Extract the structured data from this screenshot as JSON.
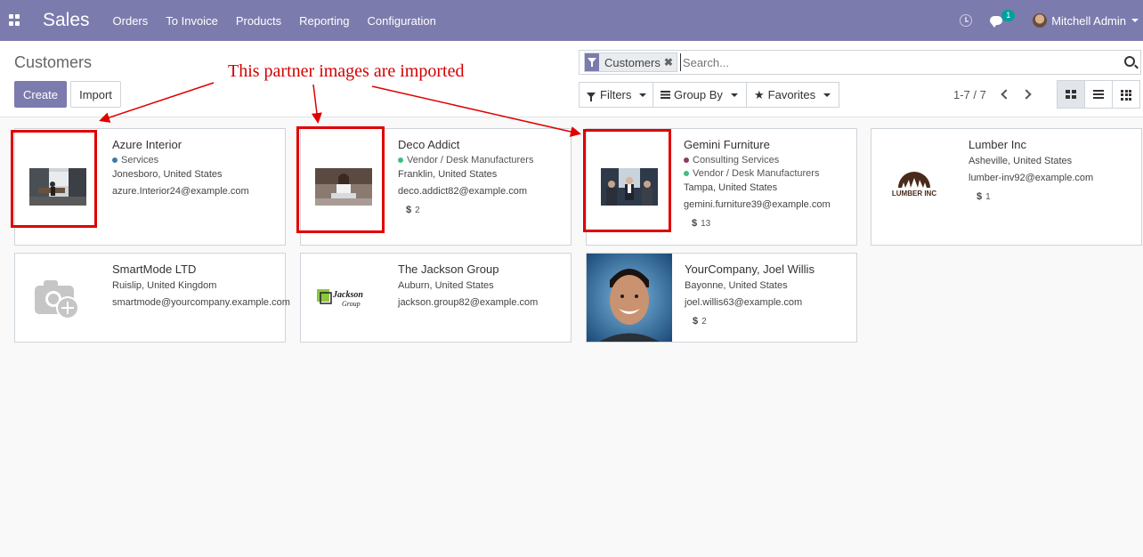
{
  "navbar": {
    "app_name": "Sales",
    "menu": [
      "Orders",
      "To Invoice",
      "Products",
      "Reporting",
      "Configuration"
    ],
    "chat_badge": "1",
    "user_name": "Mitchell Admin",
    "bg_color": "#7c7bad"
  },
  "control": {
    "breadcrumb": "Customers",
    "create_label": "Create",
    "import_label": "Import",
    "facet_label": "Customers",
    "search_placeholder": "Search...",
    "filters_label": "Filters",
    "groupby_label": "Group By",
    "favorites_label": "Favorites",
    "pager": "1-7 / 7"
  },
  "annotation": {
    "text": "This partner images are imported",
    "color": "#e00000"
  },
  "cards": [
    {
      "name": "Azure Interior",
      "tags": [
        {
          "label": "Services",
          "color": "#3d7aa8"
        }
      ],
      "address": "Jonesboro, United States",
      "email": "azure.Interior24@example.com",
      "sales": ""
    },
    {
      "name": "Deco Addict",
      "tags": [
        {
          "label": "Vendor / Desk Manufacturers",
          "color": "#3fbf7f"
        }
      ],
      "address": "Franklin, United States",
      "email": "deco.addict82@example.com",
      "sales": "2"
    },
    {
      "name": "Gemini Furniture",
      "tags": [
        {
          "label": "Consulting Services",
          "color": "#8a3e5a"
        },
        {
          "label": "Vendor / Desk Manufacturers",
          "color": "#3fbf7f"
        }
      ],
      "address": "Tampa, United States",
      "email": "gemini.furniture39@example.com",
      "sales": "13"
    },
    {
      "name": "Lumber Inc",
      "tags": [],
      "address": "Asheville, United States",
      "email": "lumber-inv92@example.com",
      "sales": "1",
      "logo": "LUMBER INC"
    },
    {
      "name": "SmartMode LTD",
      "tags": [],
      "address": "Ruislip, United Kingdom",
      "email": "smartmode@yourcompany.example.com",
      "sales": ""
    },
    {
      "name": "The Jackson Group",
      "tags": [],
      "address": "Auburn, United States",
      "email": "jackson.group82@example.com",
      "sales": "",
      "logo": "Jackson Group"
    },
    {
      "name": "YourCompany, Joel Willis",
      "tags": [],
      "address": "Bayonne, United States",
      "email": "joel.willis63@example.com",
      "sales": "2"
    }
  ],
  "icons": [
    "apps-icon",
    "clock-icon",
    "chat-icon",
    "filter-icon",
    "search-icon",
    "star-icon",
    "kanban-icon",
    "list-icon",
    "grid-icon",
    "chevron-left-icon",
    "chevron-right-icon",
    "camera-add-icon"
  ]
}
